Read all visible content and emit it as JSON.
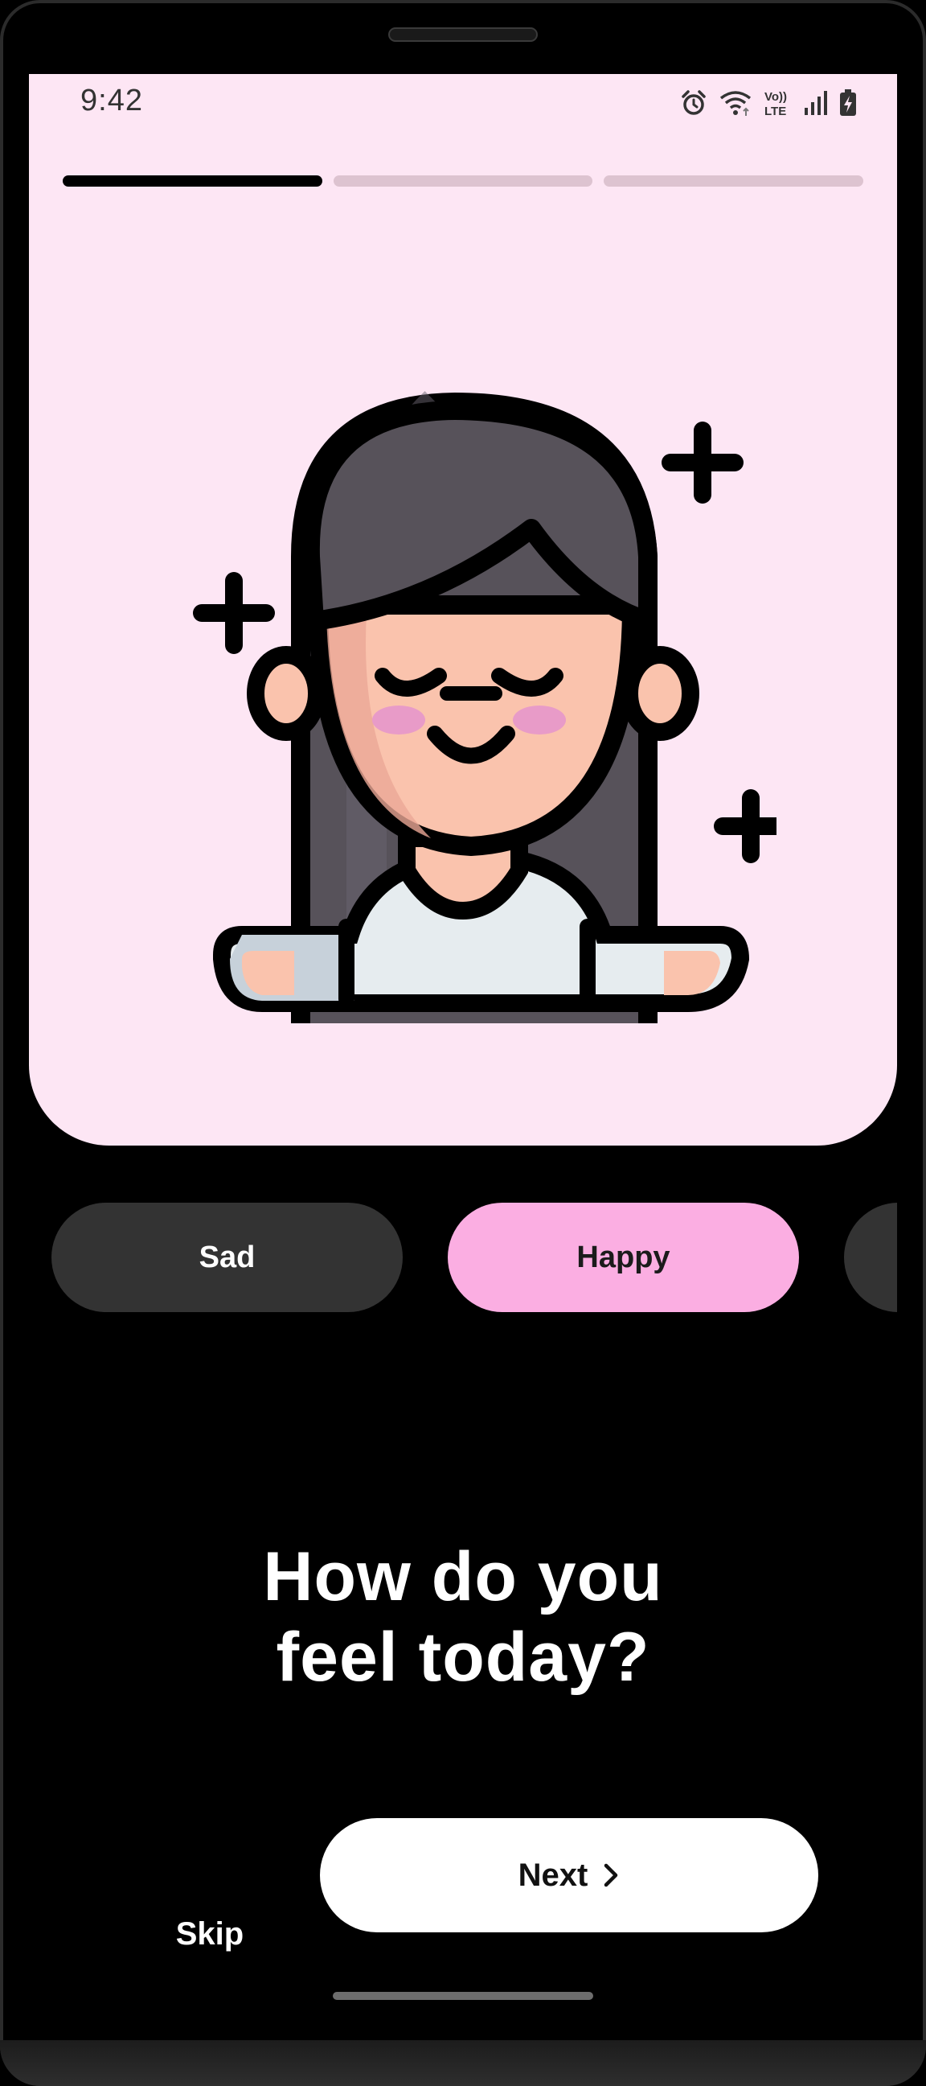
{
  "status_bar": {
    "time": "9:42",
    "icons": [
      "alarm-icon",
      "wifi-icon",
      "volte-icon",
      "signal-icon",
      "battery-charging-icon"
    ],
    "volte_top": "Vo))",
    "volte_bottom": "LTE"
  },
  "onboarding": {
    "progress": {
      "current_step": 1,
      "total_steps": 3
    },
    "illustration": "calm-girl-illustration",
    "moods": [
      {
        "label": "Sad",
        "selected": false
      },
      {
        "label": "Happy",
        "selected": true
      },
      {
        "label": "",
        "selected": false
      }
    ],
    "question_line1": "How do you",
    "question_line2": "feel today?",
    "skip_label": "Skip",
    "next_label": "Next"
  },
  "colors": {
    "hero_background": "#fde6f4",
    "selected_chip": "#fbaee2",
    "chip": "#333333",
    "progress_active": "#000000",
    "progress_inactive": "#ddc3d0"
  }
}
